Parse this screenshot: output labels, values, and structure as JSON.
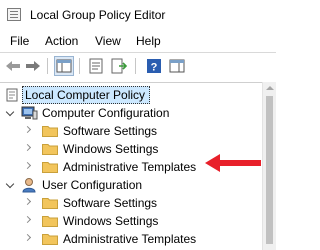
{
  "window": {
    "title": "Local Group Policy Editor"
  },
  "menu": {
    "file": "File",
    "action": "Action",
    "view": "View",
    "help": "Help"
  },
  "toolbar": {
    "buttons": [
      "back-arrow-icon",
      "forward-arrow-icon",
      "show-hide-console-tree-icon",
      "properties-icon",
      "export-list-icon",
      "help-icon",
      "show-hide-action-pane-icon"
    ]
  },
  "tree": {
    "root": {
      "label": "Local Computer Policy",
      "icon": "policy-scroll-icon"
    },
    "computer_config": {
      "label": "Computer Configuration",
      "icon": "computer-icon",
      "children": [
        "Software Settings",
        "Windows Settings",
        "Administrative Templates"
      ]
    },
    "user_config": {
      "label": "User Configuration",
      "icon": "user-icon",
      "children": [
        "Software Settings",
        "Windows Settings",
        "Administrative Templates"
      ]
    }
  },
  "colors": {
    "highlight_arrow": "#e8202a",
    "folder": "#f2c55c",
    "selection": "#cce8ff"
  }
}
